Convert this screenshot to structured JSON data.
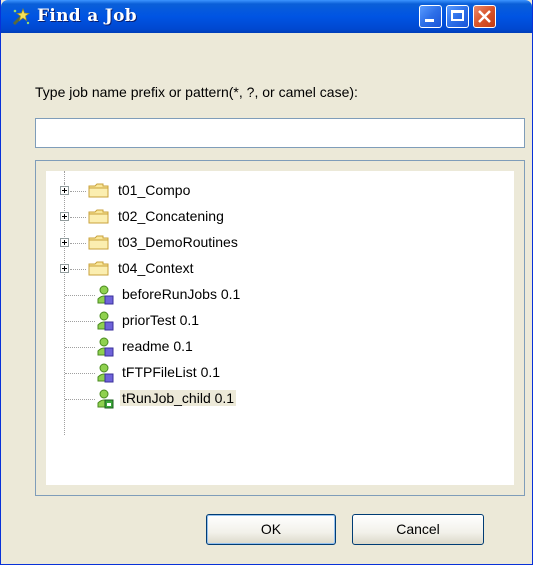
{
  "window": {
    "title": "Find a Job",
    "title_icon": "wand-icon",
    "accent_color": "#0054e3"
  },
  "search": {
    "prompt": "Type job name prefix or pattern(*, ?, or camel case):",
    "value": "",
    "placeholder": ""
  },
  "tree": {
    "folders": [
      {
        "label": "t01_Compo",
        "icon": "folder-icon"
      },
      {
        "label": "t02_Concatening",
        "icon": "folder-icon"
      },
      {
        "label": "t03_DemoRoutines",
        "icon": "folder-icon"
      },
      {
        "label": "t04_Context",
        "icon": "folder-icon"
      }
    ],
    "jobs": [
      {
        "label": "beforeRunJobs 0.1",
        "icon": "job-icon"
      },
      {
        "label": "priorTest 0.1",
        "icon": "job-icon"
      },
      {
        "label": "readme 0.1",
        "icon": "job-icon"
      },
      {
        "label": "tFTPFileList 0.1",
        "icon": "job-icon"
      },
      {
        "label": "tRunJob_child 0.1",
        "icon": "job-locked-icon",
        "selected": true
      }
    ]
  },
  "buttons": {
    "ok": "OK",
    "cancel": "Cancel"
  }
}
